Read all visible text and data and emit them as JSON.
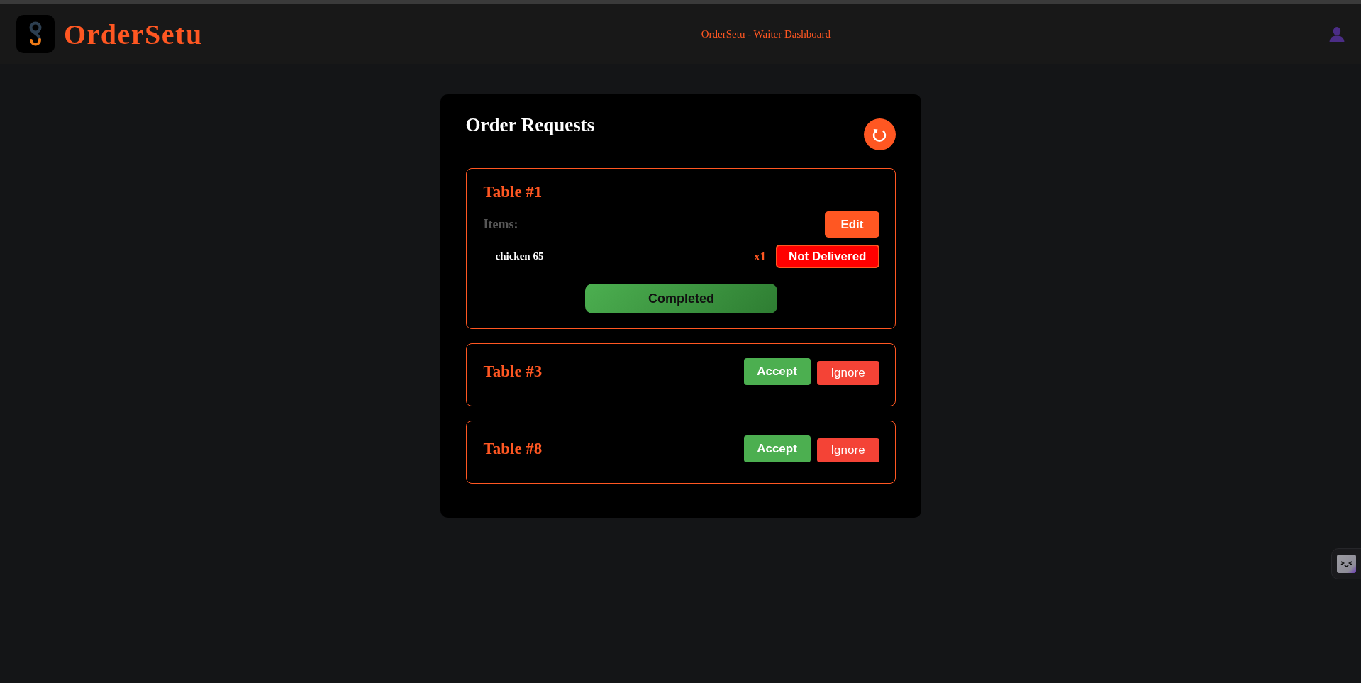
{
  "header": {
    "brand": "OrderSetu",
    "title": "OrderSetu - Waiter Dashboard"
  },
  "panel": {
    "title": "Order Requests"
  },
  "orders": [
    {
      "kind": "active",
      "table": "Table #1",
      "items_label": "Items:",
      "edit_label": "Edit",
      "items": [
        {
          "name": "chicken 65",
          "quantity": "x1",
          "status": "Not Delivered",
          "delivered": false
        }
      ],
      "complete_label": "Completed"
    },
    {
      "kind": "request",
      "table": "Table #3",
      "accept_label": "Accept",
      "ignore_label": "Ignore"
    },
    {
      "kind": "request",
      "table": "Table #8",
      "accept_label": "Accept",
      "ignore_label": "Ignore"
    }
  ]
}
